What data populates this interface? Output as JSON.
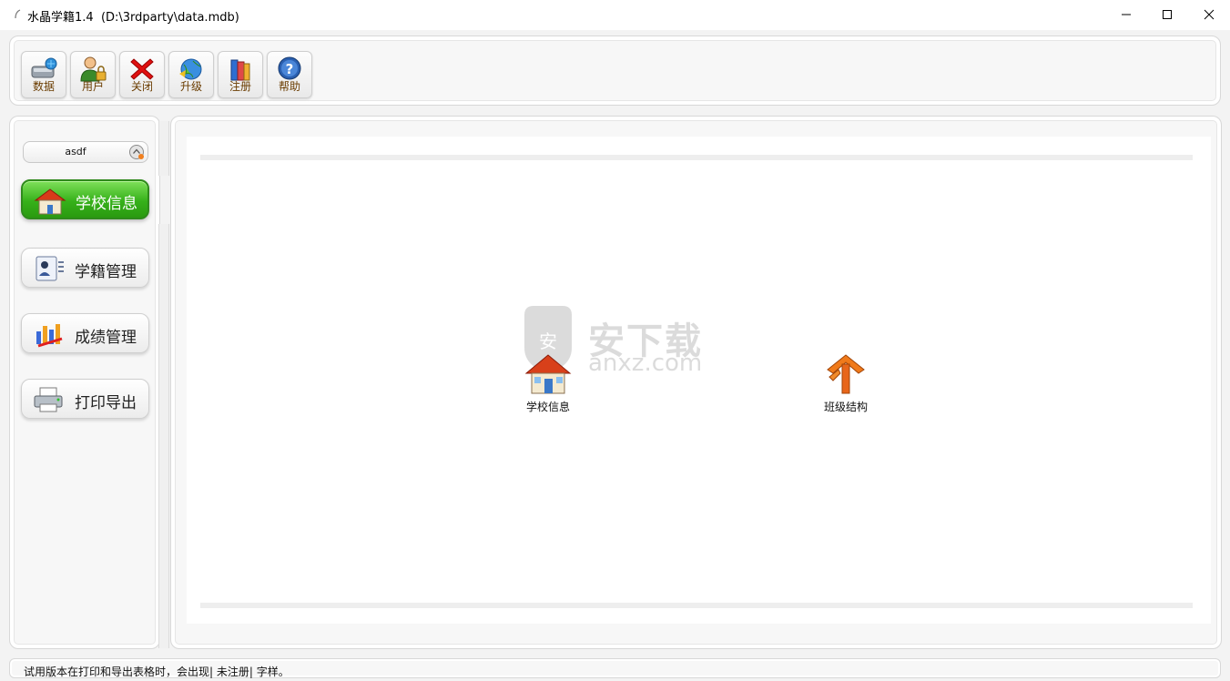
{
  "window": {
    "title": "水晶学籍1.4  (D:\\3rdparty\\data.mdb)",
    "minimize": "minimize-icon",
    "maximize": "maximize-icon",
    "close": "close-icon"
  },
  "toolbar": {
    "buttons": [
      {
        "label": "数据",
        "icon": "database-drive-icon"
      },
      {
        "label": "用户",
        "icon": "user-lock-icon"
      },
      {
        "label": "关闭",
        "icon": "red-x-icon"
      },
      {
        "label": "升级",
        "icon": "globe-upgrade-icon"
      },
      {
        "label": "注册",
        "icon": "books-register-icon"
      },
      {
        "label": "帮助",
        "icon": "help-question-icon"
      }
    ]
  },
  "sidebar": {
    "user_combo_value": "asdf",
    "items": [
      {
        "label": "学校信息",
        "icon": "school-house-icon",
        "active": true
      },
      {
        "label": "学籍管理",
        "icon": "student-card-icon",
        "active": false
      },
      {
        "label": "成绩管理",
        "icon": "score-chart-icon",
        "active": false
      },
      {
        "label": "打印导出",
        "icon": "printer-icon",
        "active": false
      }
    ]
  },
  "content": {
    "icons": [
      {
        "label": "学校信息",
        "icon": "school-house-icon"
      },
      {
        "label": "班级结构",
        "icon": "class-structure-icon"
      }
    ],
    "watermark": {
      "title": "安下载",
      "sub": "anxz.com"
    }
  },
  "status": {
    "text": "试用版本在打印和导出表格时，会出现| 未注册| 字样。"
  },
  "colors": {
    "active_nav": "#36b11a",
    "toolbar_label": "#6a3c00",
    "frame": "#f3f3f3"
  }
}
